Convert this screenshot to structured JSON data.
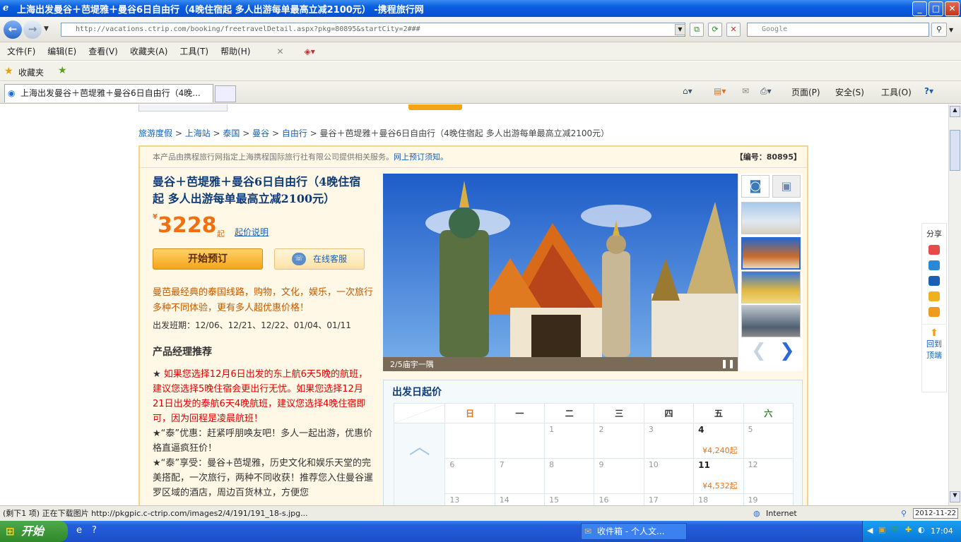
{
  "window": {
    "title": "上海出发曼谷＋芭堤雅＋曼谷6日自由行（4晚住宿起 多人出游每单最高立减2100元） -携程旅行网"
  },
  "address": {
    "url": "http://vacations.ctrip.com/booking/freetravelDetail.aspx?pkg=80895&startCity=2###",
    "search_placeholder": "Google"
  },
  "menu": [
    "文件(F)",
    "编辑(E)",
    "查看(V)",
    "收藏夹(A)",
    "工具(T)",
    "帮助(H)"
  ],
  "favorites": {
    "label": "收藏夹"
  },
  "tab": {
    "label": "上海出发曼谷＋芭堤雅＋曼谷6日自由行（4晚..."
  },
  "commandbar": {
    "page": "页面(P)",
    "safety": "安全(S)",
    "tools": "工具(O)"
  },
  "breadcrumb": [
    "旅游度假",
    "上海站",
    "泰国",
    "曼谷",
    "自由行",
    "曼谷＋芭堤雅＋曼谷6日自由行（4晚住宿起 多人出游每单最高立减2100元）"
  ],
  "notice": {
    "text": "本产品由携程旅行网指定上海携程国际旅行社有限公司提供相关服务。",
    "link": "网上预订须知。",
    "code": "【编号：80895】"
  },
  "product": {
    "title": "曼谷＋芭堤雅＋曼谷6日自由行（4晚住宿起 多人出游每单最高立减2100元）",
    "currency": "¥",
    "price": "3228",
    "price_suffix": "起",
    "price_explain": "起价说明",
    "book_label": "开始预订",
    "service_label": "在线客服",
    "tagline": "曼芭最经典的泰国线路，购物，文化，娱乐，一次旅行多种不同体验，更有多人超优惠价格！",
    "departures": "出发班期：12/06、12/21、12/22、01/04、01/11",
    "manager_heading": "产品经理推荐",
    "recs": [
      {
        "text": "★ ",
        "red": "如果您选择12月6日出发的东上航6天5晚的航班，建议您选择5晚住宿会更出行无忧。如果您选择12月21日出发的泰航6天4晚航班，建议您选择4晚住宿即可，因为回程是凌晨航班！"
      },
      {
        "text": "★“泰”优惠：赶紧呼朋唤友吧！多人一起出游，优惠价格直逼疯狂价！",
        "red": ""
      },
      {
        "text": "★“泰”享受：曼谷+芭堤雅，历史文化和娱乐天堂的完美搭配，一次旅行，两种不同收获！推荐您入住曼谷暹罗区域的酒店，周边百货林立，方便您",
        "red": ""
      }
    ]
  },
  "gallery": {
    "caption": "2/5庙宇一隅"
  },
  "calendar": {
    "heading": "出发日起价",
    "weekdays": [
      "日",
      "一",
      "二",
      "三",
      "四",
      "五",
      "六"
    ],
    "rows": [
      [
        "",
        "",
        "1",
        "2",
        "3",
        "4",
        "5"
      ],
      [
        "6",
        "7",
        "8",
        "9",
        "10",
        "11",
        "12"
      ],
      [
        "13",
        "14",
        "15",
        "16",
        "17",
        "18",
        "19"
      ]
    ],
    "prices": {
      "r0c5": "¥4,240起",
      "r1c5": "¥4,532起"
    }
  },
  "share": {
    "label": "分享",
    "top": "回到顶端"
  },
  "status": {
    "text": "(剩下1 项) 正在下载图片 http://pkgpic.c-ctrip.com/images2/4/191/191_18-s.jpg...",
    "zone": "Internet",
    "date": "2012-11-22"
  },
  "taskbar": {
    "start": "开始",
    "item": "收件箱 - 个人文...",
    "time": "17:04"
  }
}
